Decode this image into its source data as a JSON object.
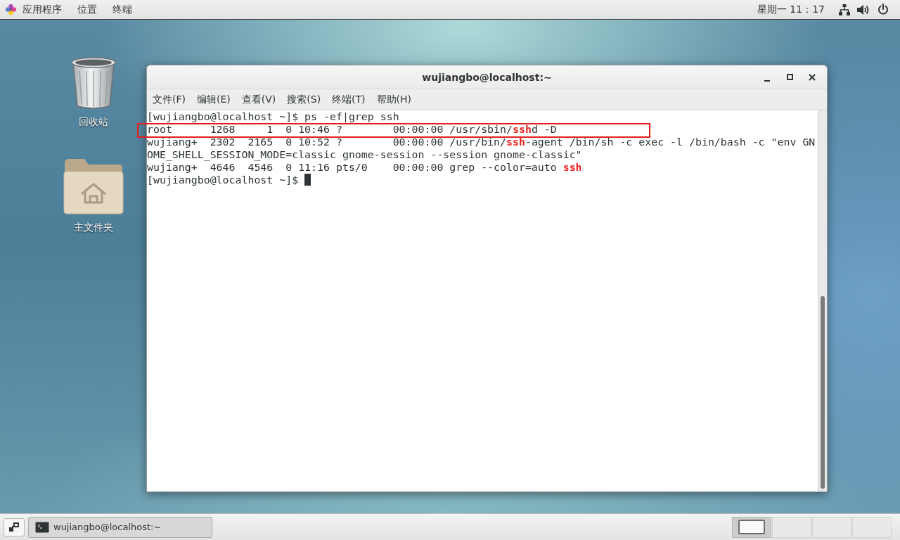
{
  "top_bar": {
    "menus": [
      {
        "kind": "apps",
        "label": "应用程序"
      },
      {
        "kind": "menu",
        "label": "位置"
      },
      {
        "kind": "menu",
        "label": "终端"
      }
    ],
    "clock": "星期一 11：17",
    "indicators": [
      {
        "kind": "network"
      },
      {
        "kind": "volume"
      },
      {
        "kind": "power"
      }
    ]
  },
  "desktop": {
    "icons": [
      {
        "kind": "trash",
        "label": "回收站"
      },
      {
        "kind": "home",
        "label": "主文件夹"
      }
    ]
  },
  "window": {
    "title": "wujiangbo@localhost:~",
    "controls": [
      {
        "kind": "minimize"
      },
      {
        "kind": "maximize"
      },
      {
        "kind": "close"
      }
    ],
    "menus": [
      "文件(F)",
      "编辑(E)",
      "查看(V)",
      "搜索(S)",
      "终端(T)",
      "帮助(H)"
    ],
    "lines": [
      {
        "highlighted": false,
        "cursor": false,
        "segments": [
          {
            "text": "[wujiangbo@localhost ~]$ ps -ef|grep ssh",
            "match": false
          }
        ]
      },
      {
        "highlighted": true,
        "cursor": false,
        "segments": [
          {
            "text": "root      1268     1  0 10:46 ?        00:00:00 /usr/sbin/",
            "match": false
          },
          {
            "text": "ssh",
            "match": true
          },
          {
            "text": "d -D",
            "match": false
          }
        ]
      },
      {
        "highlighted": false,
        "cursor": false,
        "segments": [
          {
            "text": "wujiang+  2302  2165  0 10:52 ?        00:00:00 /usr/bin/",
            "match": false
          },
          {
            "text": "ssh",
            "match": true
          },
          {
            "text": "-agent /bin/sh -c exec -l /bin/bash -c \"env GN",
            "match": false
          }
        ]
      },
      {
        "highlighted": false,
        "cursor": false,
        "segments": [
          {
            "text": "OME_SHELL_SESSION_MODE=classic gnome-session --session gnome-classic\"",
            "match": false
          }
        ]
      },
      {
        "highlighted": false,
        "cursor": false,
        "segments": [
          {
            "text": "wujiang+  4646  4546  0 11:16 pts/0    00:00:00 grep --color=auto ",
            "match": false
          },
          {
            "text": "ssh",
            "match": true
          }
        ]
      },
      {
        "highlighted": false,
        "cursor": true,
        "segments": [
          {
            "text": "[wujiangbo@localhost ~]$ ",
            "match": false
          }
        ]
      }
    ]
  },
  "taskbar": {
    "tasks": [
      {
        "label": "wujiangbo@localhost:~",
        "selected": true
      }
    ],
    "workspaces": [
      {
        "selected": true,
        "occupied": true
      },
      {
        "selected": false,
        "occupied": false
      },
      {
        "selected": false,
        "occupied": false
      },
      {
        "selected": false,
        "occupied": false
      }
    ]
  }
}
